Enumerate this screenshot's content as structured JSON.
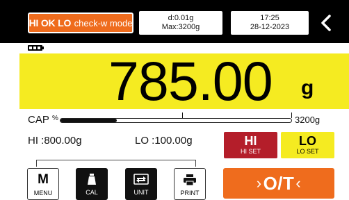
{
  "header": {
    "mode_button": {
      "bold_text": "HI OK LO",
      "text": "check-w mode"
    },
    "resolution": {
      "line1": "d:0.01g",
      "line2": "Max:3200g"
    },
    "datetime": {
      "time": "17:25",
      "date": "28-12-2023"
    },
    "back_icon": "chevron-left-icon"
  },
  "status": {
    "battery_icon": "battery-icon",
    "battery_level": 1.0
  },
  "display": {
    "weight": "785.00",
    "unit": "g",
    "band_color": "#f5eb21"
  },
  "capacity": {
    "label": "CAP",
    "percent_symbol": "%",
    "max_label": "3200g",
    "fill_fraction": 0.245
  },
  "limits": {
    "hi_value": "HI :800.00g",
    "lo_value": "LO :100.00g"
  },
  "set_buttons": {
    "hi": {
      "big": "HI",
      "small": "HI SET",
      "color": "#b41e2a"
    },
    "lo": {
      "big": "LO",
      "small": "LO SET",
      "color": "#f5eb21"
    }
  },
  "keys": {
    "menu": {
      "glyph": "M",
      "label": "MENU"
    },
    "cal": {
      "label": "CAL",
      "icon": "weight-icon"
    },
    "unit": {
      "label": "UNIT",
      "icon": "swap-icon"
    },
    "print": {
      "label": "PRINT",
      "icon": "printer-icon"
    }
  },
  "zero_button": {
    "label": "O/T",
    "left_arrow": "›",
    "right_arrow": "‹",
    "color": "#ef6c1d"
  }
}
